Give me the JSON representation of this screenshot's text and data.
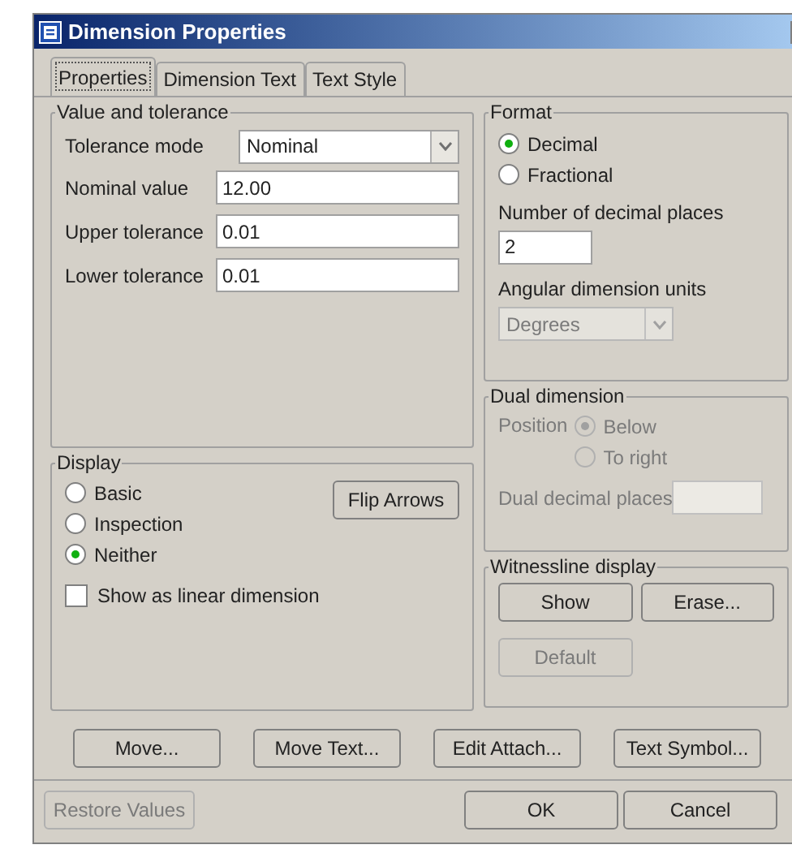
{
  "window": {
    "title": "Dimension Properties"
  },
  "tabs": [
    {
      "label": "Properties",
      "selected": true
    },
    {
      "label": "Dimension Text",
      "selected": false
    },
    {
      "label": "Text Style",
      "selected": false
    }
  ],
  "value_and_tolerance": {
    "title": "Value and tolerance",
    "tolerance_mode": {
      "label": "Tolerance mode",
      "value": "Nominal"
    },
    "fields": [
      {
        "label": "Nominal value",
        "value": "12.00"
      },
      {
        "label": "Upper tolerance",
        "value": "0.01"
      },
      {
        "label": "Lower tolerance",
        "value": "0.01"
      }
    ]
  },
  "display": {
    "title": "Display",
    "options": [
      {
        "label": "Basic",
        "selected": false
      },
      {
        "label": "Inspection",
        "selected": false
      },
      {
        "label": "Neither",
        "selected": true
      }
    ],
    "flip_button": "Flip Arrows",
    "checkbox": {
      "label": "Show as linear dimension",
      "checked": false
    }
  },
  "format": {
    "title": "Format",
    "options": [
      {
        "label": "Decimal",
        "selected": true
      },
      {
        "label": "Fractional",
        "selected": false
      }
    ],
    "decimal_places": {
      "label": "Number of decimal places",
      "value": "2"
    },
    "angular_units": {
      "label": "Angular dimension units",
      "value": "Degrees",
      "disabled": true
    }
  },
  "dual_dimension": {
    "title": "Dual dimension",
    "disabled": true,
    "position_label": "Position",
    "options": [
      {
        "label": "Below",
        "selected": true
      },
      {
        "label": "To right",
        "selected": false
      }
    ],
    "decimal_places_label": "Dual decimal places"
  },
  "witnessline": {
    "title": "Witnessline display",
    "buttons": [
      {
        "label": "Show",
        "disabled": false
      },
      {
        "label": "Erase...",
        "disabled": false
      },
      {
        "label": "Default",
        "disabled": true
      }
    ]
  },
  "action_buttons": [
    {
      "label": "Move...",
      "disabled": false
    },
    {
      "label": "Move Text...",
      "disabled": false
    },
    {
      "label": "Edit Attach...",
      "disabled": false
    },
    {
      "label": "Text Symbol...",
      "disabled": false
    }
  ],
  "footer_buttons": [
    {
      "label": "Restore Values",
      "disabled": true
    },
    {
      "label": "OK",
      "disabled": false
    },
    {
      "label": "Cancel",
      "disabled": false
    }
  ]
}
